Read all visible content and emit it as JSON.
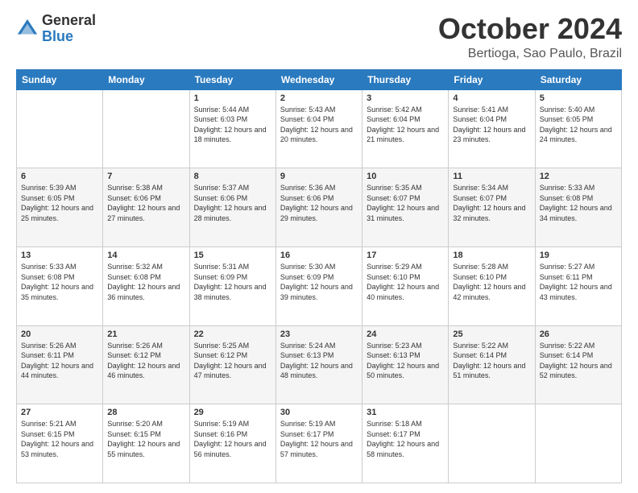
{
  "header": {
    "logo_general": "General",
    "logo_blue": "Blue",
    "month": "October 2024",
    "location": "Bertioga, Sao Paulo, Brazil"
  },
  "weekdays": [
    "Sunday",
    "Monday",
    "Tuesday",
    "Wednesday",
    "Thursday",
    "Friday",
    "Saturday"
  ],
  "weeks": [
    [
      {
        "day": "",
        "info": ""
      },
      {
        "day": "",
        "info": ""
      },
      {
        "day": "1",
        "info": "Sunrise: 5:44 AM\nSunset: 6:03 PM\nDaylight: 12 hours and 18 minutes."
      },
      {
        "day": "2",
        "info": "Sunrise: 5:43 AM\nSunset: 6:04 PM\nDaylight: 12 hours and 20 minutes."
      },
      {
        "day": "3",
        "info": "Sunrise: 5:42 AM\nSunset: 6:04 PM\nDaylight: 12 hours and 21 minutes."
      },
      {
        "day": "4",
        "info": "Sunrise: 5:41 AM\nSunset: 6:04 PM\nDaylight: 12 hours and 23 minutes."
      },
      {
        "day": "5",
        "info": "Sunrise: 5:40 AM\nSunset: 6:05 PM\nDaylight: 12 hours and 24 minutes."
      }
    ],
    [
      {
        "day": "6",
        "info": "Sunrise: 5:39 AM\nSunset: 6:05 PM\nDaylight: 12 hours and 25 minutes."
      },
      {
        "day": "7",
        "info": "Sunrise: 5:38 AM\nSunset: 6:06 PM\nDaylight: 12 hours and 27 minutes."
      },
      {
        "day": "8",
        "info": "Sunrise: 5:37 AM\nSunset: 6:06 PM\nDaylight: 12 hours and 28 minutes."
      },
      {
        "day": "9",
        "info": "Sunrise: 5:36 AM\nSunset: 6:06 PM\nDaylight: 12 hours and 29 minutes."
      },
      {
        "day": "10",
        "info": "Sunrise: 5:35 AM\nSunset: 6:07 PM\nDaylight: 12 hours and 31 minutes."
      },
      {
        "day": "11",
        "info": "Sunrise: 5:34 AM\nSunset: 6:07 PM\nDaylight: 12 hours and 32 minutes."
      },
      {
        "day": "12",
        "info": "Sunrise: 5:33 AM\nSunset: 6:08 PM\nDaylight: 12 hours and 34 minutes."
      }
    ],
    [
      {
        "day": "13",
        "info": "Sunrise: 5:33 AM\nSunset: 6:08 PM\nDaylight: 12 hours and 35 minutes."
      },
      {
        "day": "14",
        "info": "Sunrise: 5:32 AM\nSunset: 6:08 PM\nDaylight: 12 hours and 36 minutes."
      },
      {
        "day": "15",
        "info": "Sunrise: 5:31 AM\nSunset: 6:09 PM\nDaylight: 12 hours and 38 minutes."
      },
      {
        "day": "16",
        "info": "Sunrise: 5:30 AM\nSunset: 6:09 PM\nDaylight: 12 hours and 39 minutes."
      },
      {
        "day": "17",
        "info": "Sunrise: 5:29 AM\nSunset: 6:10 PM\nDaylight: 12 hours and 40 minutes."
      },
      {
        "day": "18",
        "info": "Sunrise: 5:28 AM\nSunset: 6:10 PM\nDaylight: 12 hours and 42 minutes."
      },
      {
        "day": "19",
        "info": "Sunrise: 5:27 AM\nSunset: 6:11 PM\nDaylight: 12 hours and 43 minutes."
      }
    ],
    [
      {
        "day": "20",
        "info": "Sunrise: 5:26 AM\nSunset: 6:11 PM\nDaylight: 12 hours and 44 minutes."
      },
      {
        "day": "21",
        "info": "Sunrise: 5:26 AM\nSunset: 6:12 PM\nDaylight: 12 hours and 46 minutes."
      },
      {
        "day": "22",
        "info": "Sunrise: 5:25 AM\nSunset: 6:12 PM\nDaylight: 12 hours and 47 minutes."
      },
      {
        "day": "23",
        "info": "Sunrise: 5:24 AM\nSunset: 6:13 PM\nDaylight: 12 hours and 48 minutes."
      },
      {
        "day": "24",
        "info": "Sunrise: 5:23 AM\nSunset: 6:13 PM\nDaylight: 12 hours and 50 minutes."
      },
      {
        "day": "25",
        "info": "Sunrise: 5:22 AM\nSunset: 6:14 PM\nDaylight: 12 hours and 51 minutes."
      },
      {
        "day": "26",
        "info": "Sunrise: 5:22 AM\nSunset: 6:14 PM\nDaylight: 12 hours and 52 minutes."
      }
    ],
    [
      {
        "day": "27",
        "info": "Sunrise: 5:21 AM\nSunset: 6:15 PM\nDaylight: 12 hours and 53 minutes."
      },
      {
        "day": "28",
        "info": "Sunrise: 5:20 AM\nSunset: 6:15 PM\nDaylight: 12 hours and 55 minutes."
      },
      {
        "day": "29",
        "info": "Sunrise: 5:19 AM\nSunset: 6:16 PM\nDaylight: 12 hours and 56 minutes."
      },
      {
        "day": "30",
        "info": "Sunrise: 5:19 AM\nSunset: 6:17 PM\nDaylight: 12 hours and 57 minutes."
      },
      {
        "day": "31",
        "info": "Sunrise: 5:18 AM\nSunset: 6:17 PM\nDaylight: 12 hours and 58 minutes."
      },
      {
        "day": "",
        "info": ""
      },
      {
        "day": "",
        "info": ""
      }
    ]
  ]
}
